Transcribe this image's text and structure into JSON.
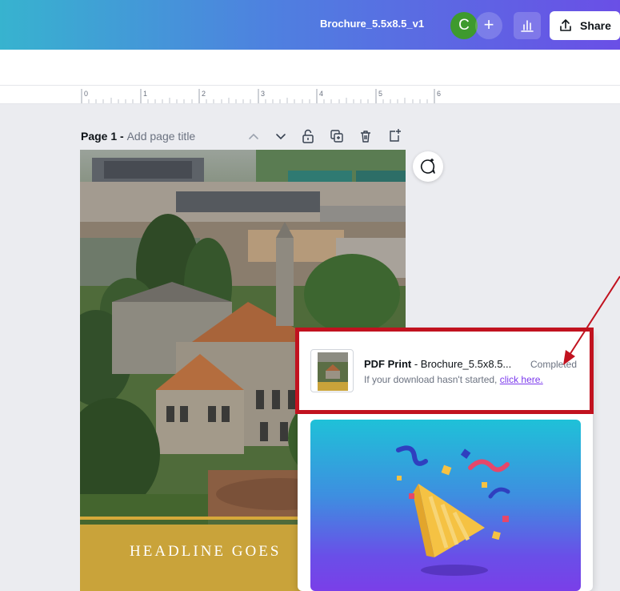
{
  "header": {
    "doc_title": "Brochure_5.5x8.5_v1",
    "avatar_initial": "C",
    "add_label": "+",
    "share_label": "Share"
  },
  "ruler": {
    "marks": [
      "0",
      "1",
      "2",
      "3",
      "4",
      "5",
      "6"
    ]
  },
  "page": {
    "label": "Page 1 - ",
    "placeholder": "Add page title",
    "headline": "HEADLINE GOES"
  },
  "download": {
    "type": "PDF Print",
    "separator": " - ",
    "filename": "Brochure_5.5x8.5...",
    "status": "Completed",
    "hint": "If your download hasn't started, ",
    "link": "click here."
  },
  "colors": {
    "highlight": "#c1121f",
    "avatar": "#3e9a2e",
    "link": "#7c3aed"
  },
  "icons": [
    "share-icon",
    "insights-icon",
    "chevron-up-icon",
    "chevron-down-icon",
    "lock-icon",
    "duplicate-icon",
    "trash-icon",
    "add-page-icon",
    "ai-comment-icon",
    "party-popper-icon",
    "arrow-icon"
  ]
}
